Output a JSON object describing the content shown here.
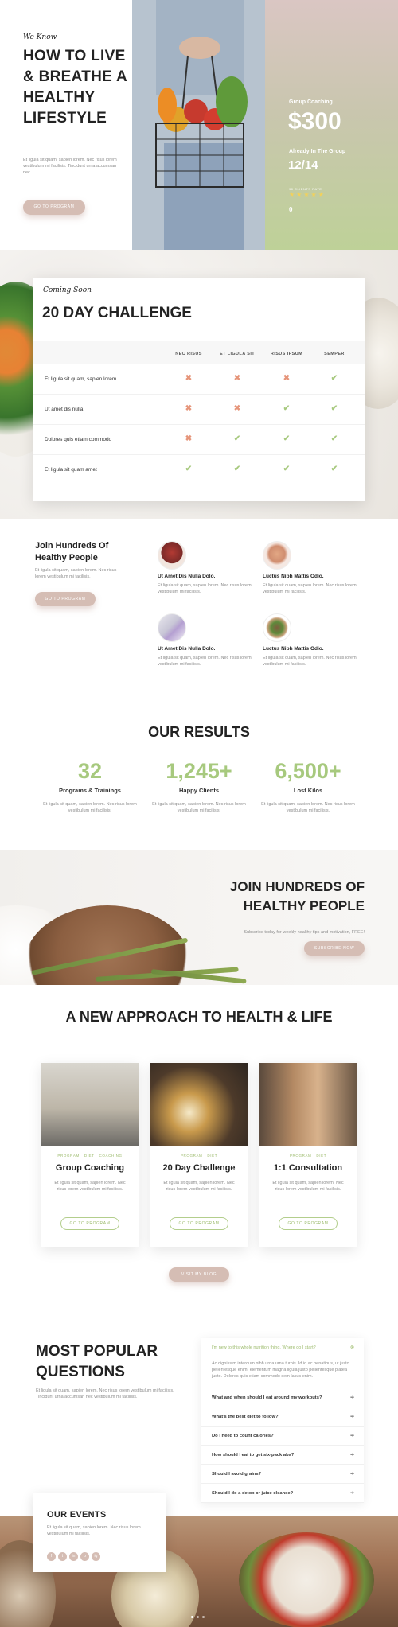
{
  "hero": {
    "tag": "We Know",
    "title": "HOW TO LIVE & BREATHE A HEALTHY LIFESTYLE",
    "text": "Et ligula sit quam, sapien lorem. Nec risus lorem vestibulum mi facilisis. Tincidunt urna accumsan nec.",
    "button": "GO TO PROGRAM",
    "group_label": "Group Coaching",
    "price": "$300",
    "already_label": "Already In The Group",
    "count": "12/14",
    "reviews_label": "90 CLIENTS RATE",
    "rating": 5,
    "zero": "0"
  },
  "challenge": {
    "tag": "Coming Soon",
    "title": "20 DAY CHALLENGE",
    "columns": [
      "NEC RISUS",
      "ET LIGULA SIT",
      "RISUS IPSUM",
      "SEMPER"
    ],
    "rows": [
      {
        "label": "Et ligula sit quam, sapien lorem",
        "marks": [
          "x",
          "x",
          "x",
          "check"
        ]
      },
      {
        "label": "Ut amet dis nulla",
        "marks": [
          "x",
          "x",
          "check",
          "check"
        ]
      },
      {
        "label": "Dolores quis etiam commodo",
        "marks": [
          "x",
          "check",
          "check",
          "check"
        ]
      },
      {
        "label": "Et ligula sit quam amet",
        "marks": [
          "check",
          "check",
          "check",
          "check"
        ]
      }
    ]
  },
  "hundreds": {
    "title": "Join Hundreds Of Healthy People",
    "text": "Et ligula sit quam, sapien lorem. Nec risus lorem vestibulum mi facilisis.",
    "button": "GO TO PROGRAM",
    "people": [
      {
        "name": "Ut Amet Dis Nulla Dolo.",
        "desc": "Et ligula sit quam, sapien lorem. Nec risus lorem vestibulum mi facilisis."
      },
      {
        "name": "Luctus Nibh Mattis Odio.",
        "desc": "Et ligula sit quam, sapien lorem. Nec risus lorem vestibulum mi facilisis."
      },
      {
        "name": "Ut Amet Dis Nulla Dolo.",
        "desc": "Et ligula sit quam, sapien lorem. Nec risus lorem vestibulum mi facilisis."
      },
      {
        "name": "Luctus Nibh Mattis Odio.",
        "desc": "Et ligula sit quam, sapien lorem. Nec risus lorem vestibulum mi facilisis."
      }
    ]
  },
  "results": {
    "title": "OUR RESULTS",
    "stats": [
      {
        "number": "32",
        "label": "Programs & Trainings",
        "text": "Et ligula sit quam, sapien lorem. Nec risus lorem vestibulum mi facilisis."
      },
      {
        "number": "1,245+",
        "label": "Happy Clients",
        "text": "Et ligula sit quam, sapien lorem. Nec risus lorem vestibulum mi facilisis."
      },
      {
        "number": "6,500+",
        "label": "Lost Kilos",
        "text": "Et ligula sit quam, sapien lorem. Nec risus lorem vestibulum mi facilisis."
      }
    ]
  },
  "join": {
    "title": "JOIN HUNDREDS OF HEALTHY PEOPLE",
    "text": "Subscribe today for weekly healthy tips and motivation, FREE!",
    "button": "SUBSCRIBE NOW"
  },
  "approach": {
    "title": "A NEW APPROACH TO HEALTH & LIFE",
    "programs": [
      {
        "tags": [
          "PROGRAM",
          "DIET",
          "COACHING"
        ],
        "name": "Group Coaching",
        "text": "Et ligula sit quam, sapien lorem. Nec risus lorem vestibulum mi facilisis.",
        "button": "GO TO PROGRAM"
      },
      {
        "tags": [
          "PROGRAM",
          "DIET"
        ],
        "name": "20 Day Challenge",
        "text": "Et ligula sit quam, sapien lorem. Nec risus lorem vestibulum mi facilisis.",
        "button": "GO TO PROGRAM"
      },
      {
        "tags": [
          "PROGRAM",
          "DIET"
        ],
        "name": "1:1 Consultation",
        "text": "Et ligula sit quam, sapien lorem. Nec risus lorem vestibulum mi facilisis.",
        "button": "GO TO PROGRAM"
      }
    ],
    "button": "VISIT MY BLOG"
  },
  "faq": {
    "title": "MOST POPULAR QUESTIONS",
    "text": "Et ligula sit quam, sapien lorem. Nec risus lorem vestibulum mi facilisis. Tincidunt urna accumsan nec vestibulum mi facilisis.",
    "open": {
      "question": "I'm new to this whole nutrition thing. Where do I start?",
      "answer": "Ac dignissim interdum nibh urna urna turpis. Id id ac penatibus, ut justo pellentesque enim, elementum magna ligula justo pellentesque platea justo. Dolores quis etiam commodo sem lacus enim."
    },
    "questions": [
      "What and when should I eat around my workouts?",
      "What's the best diet to follow?",
      "Do I need to count calories?",
      "How should I eat to get six-pack abs?",
      "Should I avoid grains?",
      "Should I do a detox or juice cleanse?"
    ]
  },
  "events": {
    "title": "OUR EVENTS",
    "text": "Et ligula sit quam, sapien lorem. Nec risus lorem vestibulum mi facilisis.",
    "social": [
      "f",
      "t",
      "in",
      "p",
      "ig"
    ]
  },
  "colors": {
    "green": "#a7c97e",
    "rose": "#d5bdb4",
    "cross": "#e6957a"
  }
}
